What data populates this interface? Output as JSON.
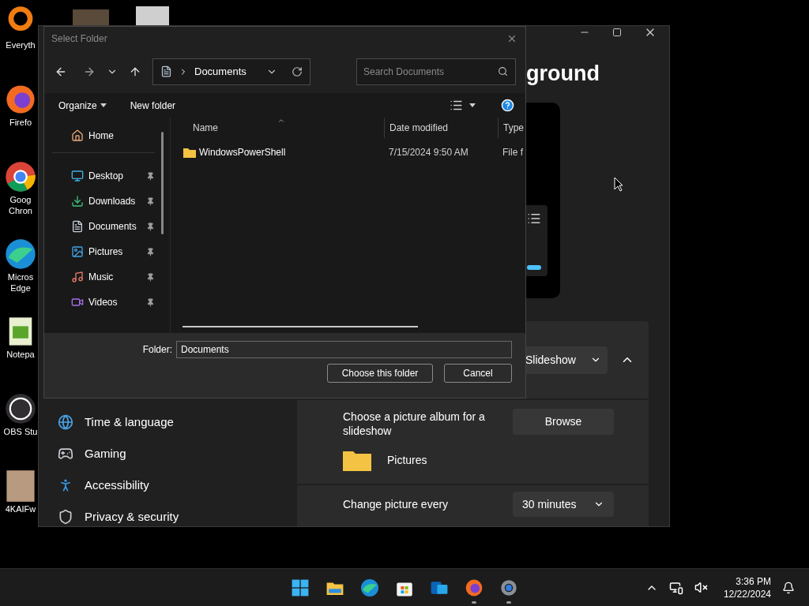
{
  "desktop": {
    "icons": [
      {
        "kind": "ring",
        "lines": [
          "Everyth"
        ]
      },
      {
        "kind": "fox",
        "lines": [
          "Firefo"
        ]
      },
      {
        "kind": "chrome",
        "lines": [
          "Goog",
          "Chron"
        ]
      },
      {
        "kind": "wave",
        "lines": [
          "Micros",
          "Edge"
        ]
      },
      {
        "kind": "notepad",
        "lines": [
          "Notepa"
        ]
      },
      {
        "kind": "obs",
        "lines": [
          "OBS Stu"
        ]
      },
      {
        "kind": "photo",
        "lines": [
          "4KAIFw"
        ]
      }
    ]
  },
  "settings_window": {
    "heading": "ground",
    "nav_items": [
      {
        "kind": "time",
        "label": "Time & language"
      },
      {
        "kind": "gaming",
        "label": "Gaming"
      },
      {
        "kind": "accessibility",
        "label": "Accessibility"
      },
      {
        "kind": "privacy",
        "label": "Privacy & security"
      }
    ],
    "background_type": {
      "value": "Slideshow",
      "expanded": true
    },
    "album": {
      "label": "Choose a picture album for a slideshow",
      "button": "Browse",
      "folder": "Pictures"
    },
    "interval": {
      "label": "Change picture every",
      "value": "30 minutes"
    }
  },
  "dialog": {
    "title": "Select Folder",
    "address": "Documents",
    "search": {
      "placeholder": "Search Documents"
    },
    "toolbar": {
      "organize": "Organize",
      "new_folder": "New folder"
    },
    "nav_items": [
      {
        "kind": "home",
        "label": "Home",
        "pinned": false
      },
      {
        "kind": "desktop",
        "label": "Desktop",
        "pinned": true
      },
      {
        "kind": "downloads",
        "label": "Downloads",
        "pinned": true
      },
      {
        "kind": "documents",
        "label": "Documents",
        "pinned": true
      },
      {
        "kind": "pictures",
        "label": "Pictures",
        "pinned": true
      },
      {
        "kind": "music",
        "label": "Music",
        "pinned": true
      },
      {
        "kind": "videos",
        "label": "Videos",
        "pinned": true
      }
    ],
    "columns": [
      {
        "label": "Name",
        "sorted": true
      },
      {
        "label": "Date modified",
        "sorted": false
      },
      {
        "label": "Type",
        "sorted": false
      }
    ],
    "rows": [
      {
        "name": "WindowsPowerShell",
        "date_modified": "7/15/2024 9:50 AM",
        "type": "File f"
      }
    ],
    "folder_field": {
      "label": "Folder:",
      "value": "Documents"
    },
    "buttons": {
      "confirm": "Choose this folder",
      "cancel": "Cancel"
    }
  },
  "taskbar": {
    "apps": [
      {
        "kind": "start",
        "running": false
      },
      {
        "kind": "explorer",
        "running": false
      },
      {
        "kind": "wave",
        "running": false
      },
      {
        "kind": "store",
        "running": false
      },
      {
        "kind": "mail",
        "running": false
      },
      {
        "kind": "fox",
        "running": true
      },
      {
        "kind": "gear",
        "running": true
      }
    ],
    "tray": {
      "time": "3:36 PM",
      "date": "12/22/2024"
    }
  }
}
